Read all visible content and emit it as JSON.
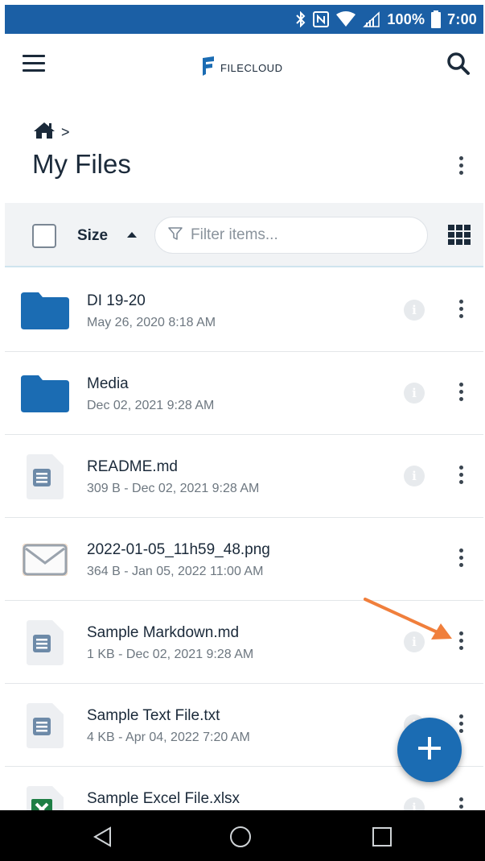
{
  "status_bar": {
    "battery": "100%",
    "time": "7:00",
    "icons": [
      "bluetooth-icon",
      "nfc-icon",
      "wifi-icon",
      "signal-icon",
      "battery-icon"
    ]
  },
  "app_bar": {
    "logo_text": "FILECLOUD",
    "icons": [
      "hamburger-menu-icon",
      "filecloud-logo-icon",
      "search-icon"
    ]
  },
  "breadcrumb": {
    "separator": ">",
    "icon": "home-icon"
  },
  "page": {
    "title": "My Files"
  },
  "toolbar": {
    "sort_label": "Size",
    "filter_placeholder": "Filter items...",
    "icons": [
      "checkbox-icon",
      "sort-ascending-icon",
      "filter-icon",
      "grid-view-icon"
    ]
  },
  "files": [
    {
      "name": "DI 19-20",
      "meta": "May 26, 2020 8:18 AM",
      "type": "folder",
      "icon": "folder-icon",
      "show_info": true
    },
    {
      "name": "Media",
      "meta": "Dec 02, 2021 9:28 AM",
      "type": "folder",
      "icon": "folder-icon",
      "show_info": true
    },
    {
      "name": "README.md",
      "meta": "309 B - Dec 02, 2021 9:28 AM",
      "type": "doc",
      "icon": "document-icon",
      "show_info": true
    },
    {
      "name": "2022-01-05_11h59_48.png",
      "meta": "364 B - Jan 05, 2022 11:00 AM",
      "type": "image",
      "icon": "envelope-thumbnail-icon",
      "show_info": false
    },
    {
      "name": "Sample Markdown.md",
      "meta": "1 KB - Dec 02, 2021 9:28 AM",
      "type": "doc",
      "icon": "document-icon",
      "show_info": true
    },
    {
      "name": "Sample Text File.txt",
      "meta": "4 KB - Apr 04, 2022 7:20 AM",
      "type": "doc",
      "icon": "document-icon",
      "show_info": true
    },
    {
      "name": "Sample Excel File.xlsx",
      "meta": "",
      "type": "excel",
      "icon": "excel-icon",
      "show_info": true
    }
  ],
  "fab": {
    "icon": "plus-icon"
  },
  "annotation": {
    "icon": "orange-arrow-annotation",
    "color": "#f07f3c"
  },
  "colors": {
    "status_bar": "#1b5fa5",
    "accent": "#1b6cb3",
    "folder": "#1b6cb3",
    "text": "#1b2a3a"
  },
  "nav_bar": {
    "icons": [
      "back-triangle-icon",
      "home-circle-icon",
      "recents-square-icon"
    ]
  }
}
